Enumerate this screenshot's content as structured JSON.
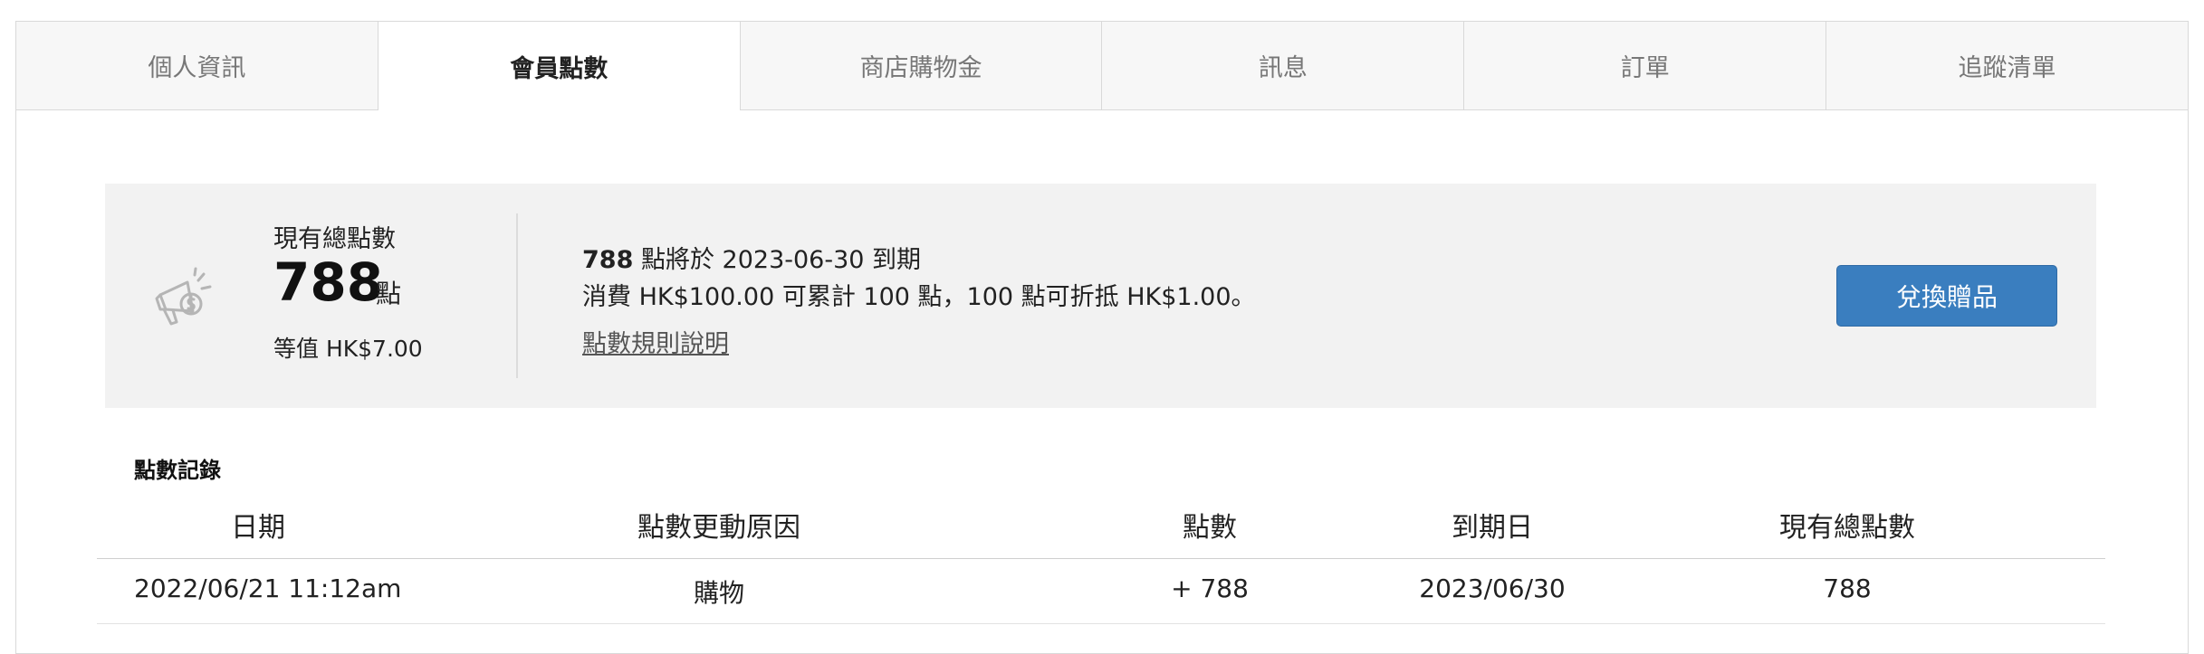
{
  "tabs": [
    {
      "label": "個人資訊"
    },
    {
      "label": "會員點數"
    },
    {
      "label": "商店購物金"
    },
    {
      "label": "訊息"
    },
    {
      "label": "訂單"
    },
    {
      "label": "追蹤清單"
    }
  ],
  "summary": {
    "total_label": "現有總點數",
    "total_points": "788",
    "unit": "點",
    "equivalent": "等值 HK$7.00",
    "expiry_points": "788",
    "expiry_text": " 點將於 2023-06-30 到期",
    "earn_rule": "消費 HK$100.00 可累計 100 點，100 點可折抵 HK$1.00。",
    "rules_link": "點數規則說明",
    "redeem_button": "兌換贈品"
  },
  "records": {
    "title": "點數記錄",
    "columns": [
      "日期",
      "點數更動原因",
      "點數",
      "到期日",
      "現有總點數"
    ],
    "rows": [
      {
        "date": "2022/06/21 11:12am",
        "reason": "購物",
        "points": "+ 788",
        "expiry": "2023/06/30",
        "total": "788"
      }
    ]
  },
  "colors": {
    "accent": "#3a7ebf",
    "summary_bg": "#f2f2f2",
    "tab_inactive_bg": "#f7f7f7"
  },
  "icons": {
    "summary": "megaphone-dollar-icon"
  }
}
